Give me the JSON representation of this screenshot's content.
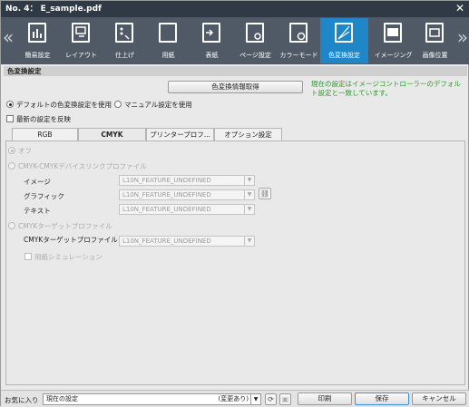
{
  "title": "No. 4： E_sample.pdf",
  "close_glyph": "✕",
  "toolbar": {
    "left_arrow": "«",
    "right_arrow": "»",
    "items": [
      {
        "label": "簡易設定",
        "icon": "simple-settings-icon"
      },
      {
        "label": "レイアウト",
        "icon": "layout-icon"
      },
      {
        "label": "仕上げ",
        "icon": "finishing-icon"
      },
      {
        "label": "用紙",
        "icon": "paper-icon"
      },
      {
        "label": "表紙",
        "icon": "cover-icon"
      },
      {
        "label": "ページ設定",
        "icon": "page-settings-icon"
      },
      {
        "label": "カラーモード",
        "icon": "color-mode-icon"
      },
      {
        "label": "色変換設定",
        "icon": "color-conversion-icon",
        "active": true
      },
      {
        "label": "イメージング",
        "icon": "imaging-icon"
      },
      {
        "label": "画像位置",
        "icon": "image-position-icon"
      }
    ]
  },
  "section": {
    "title": "色変換設定"
  },
  "get_info_button": "色変換情報取得",
  "note": "現在の設定はイメージコントローラーのデフォルト設定と一致しています。",
  "mode": {
    "default_label": "デフォルトの色変換設定を使用",
    "manual_label": "マニュアル設定を使用",
    "selected": "default"
  },
  "reflect_latest": {
    "label": "最新の設定を反映",
    "checked": false
  },
  "tabs": [
    {
      "label": "RGB"
    },
    {
      "label": "CMYK",
      "active": true
    },
    {
      "label": "プリンタープロフ..."
    },
    {
      "label": "オプション設定"
    }
  ],
  "cmyk": {
    "off_label": "オフ",
    "devicelink_label": "CMYK-CMYKデバイスリンクプロファイル",
    "image_label": "イメージ",
    "image_value": "L10N_FEATURE_UNDEFINED",
    "graphic_label": "グラフィック",
    "graphic_value": "L10N_FEATURE_UNDEFINED",
    "text_label": "テキスト",
    "text_value": "L10N_FEATURE_UNDEFINED",
    "target_label": "CMYKターゲットプロファイル",
    "target_profile_label": "CMYKターゲットプロファイル",
    "target_profile_value": "L10N_FEATURE_UNDEFINED",
    "paper_sim_label": "用紙シミュレーション"
  },
  "bottom": {
    "favorites_label": "お気に入り",
    "favorites_value": "現在の設定",
    "favorites_state": "(変更あり)",
    "print_button": "印刷",
    "save_button": "保存",
    "cancel_button": "キャンセル"
  }
}
